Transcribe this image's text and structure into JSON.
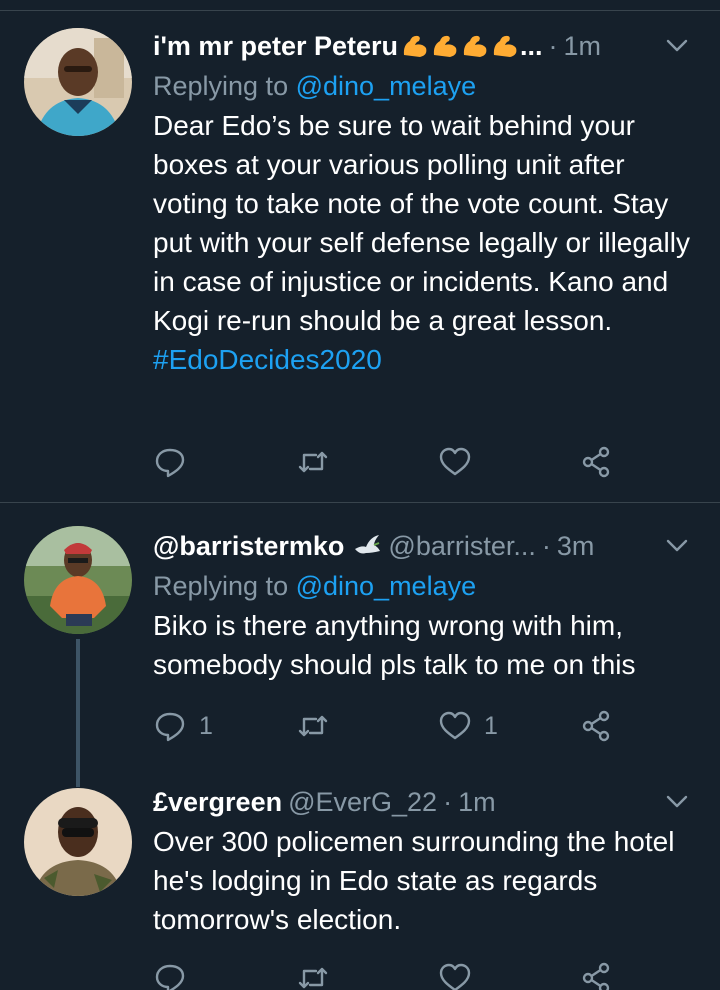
{
  "tweets": [
    {
      "display_name": "i'm mr peter Peteru",
      "name_suffix": "...",
      "handle": "",
      "time": "1m",
      "reply_prefix": "Replying to ",
      "reply_to": "@dino_melaye",
      "text": "Dear Edo’s be sure to wait behind your boxes at your various polling unit after voting to take note of the vote count. Stay put with your self defense legally or illegally in case of injustice or incidents. Kano and Kogi re-run should be a great lesson.",
      "hashtag": "#EdoDecides2020",
      "reply_count": "",
      "retweet_count": "",
      "like_count": ""
    },
    {
      "display_name": "@barristermko",
      "handle": "@barrister...",
      "time": "3m",
      "reply_prefix": "Replying to ",
      "reply_to": "@dino_melaye",
      "text": "Biko is there anything wrong with him, somebody should pls talk to me on this",
      "reply_count": "1",
      "retweet_count": "",
      "like_count": "1"
    },
    {
      "display_name": "£vergreen",
      "handle": "@EverG_22",
      "time": "1m",
      "text": "Over 300 policemen surrounding the hotel he's lodging in Edo state as regards tomorrow's election.",
      "reply_count": "",
      "retweet_count": "",
      "like_count": ""
    }
  ],
  "separator": "·",
  "colors": {
    "background": "#15202b",
    "muted": "#8899a6",
    "link": "#1da1f2",
    "divider": "#38444d",
    "emoji": "#ffac33"
  },
  "icons": [
    "reply-icon",
    "retweet-icon",
    "like-icon",
    "share-icon",
    "chevron-down-icon",
    "flexed-biceps-icon",
    "dove-icon"
  ]
}
